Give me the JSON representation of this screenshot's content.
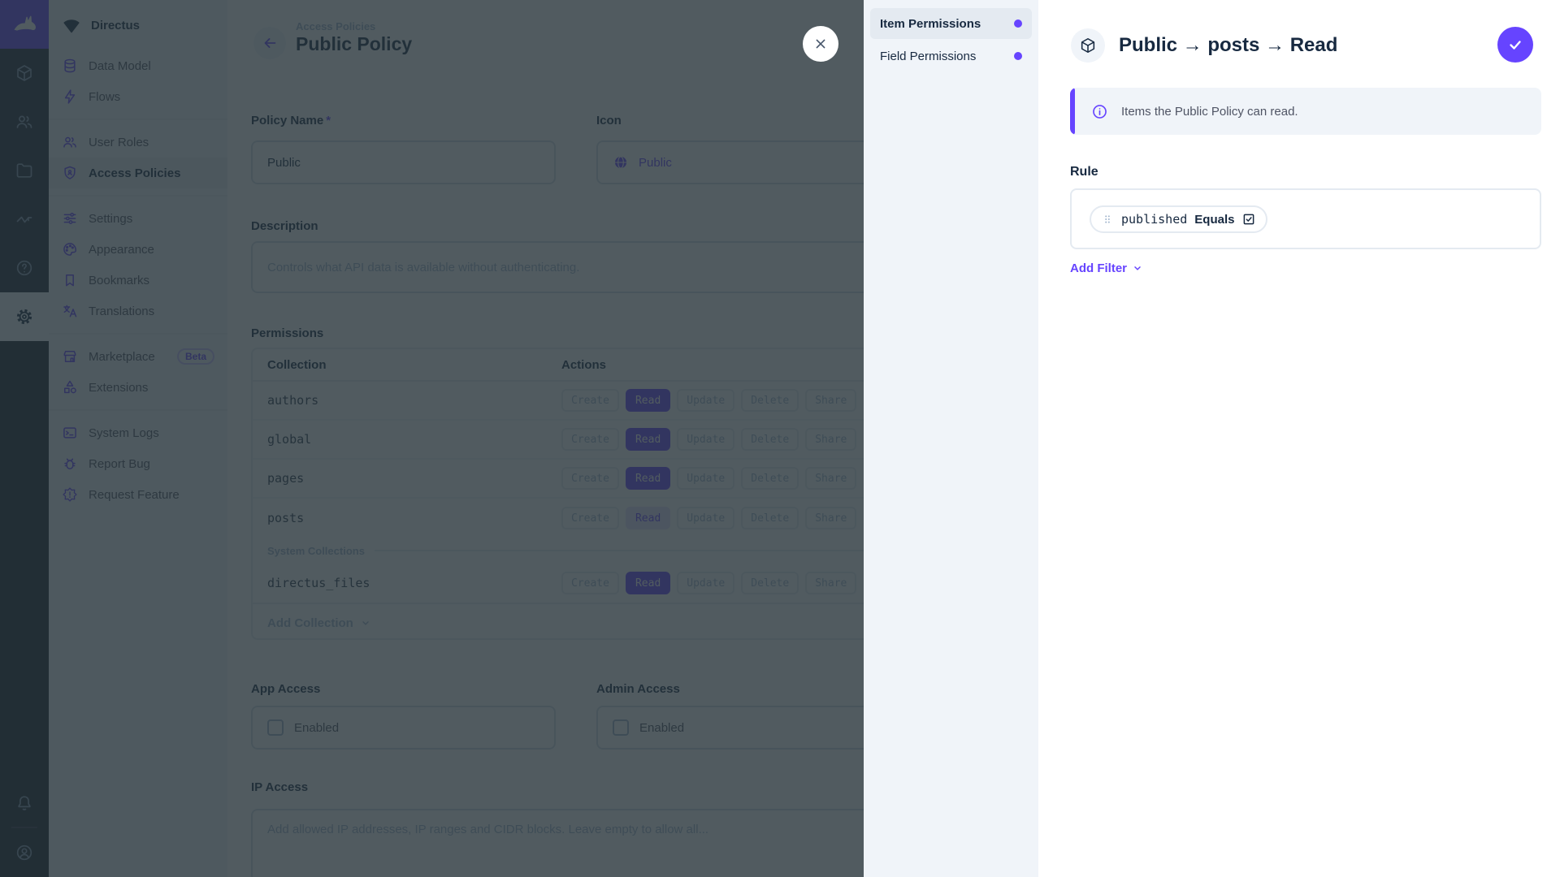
{
  "colors": {
    "accent": "#6644ff",
    "module_bar_bg": "#1d2735",
    "nav_bg": "#f0f4f9",
    "active_bg": "#e4eaf1",
    "text": "#172940",
    "text_subdued": "#a2b5cd",
    "overlay": "rgba(38,50,56,0.8)"
  },
  "nav": {
    "project_name": "Directus",
    "items": [
      {
        "label": "Data Model",
        "icon": "database-icon"
      },
      {
        "label": "Flows",
        "icon": "lightning-icon"
      },
      {
        "label": "User Roles",
        "icon": "user-roles-icon"
      },
      {
        "label": "Access Policies",
        "icon": "shield-person-icon",
        "active": true
      },
      {
        "label": "Settings",
        "icon": "tune-icon"
      },
      {
        "label": "Appearance",
        "icon": "palette-icon"
      },
      {
        "label": "Bookmarks",
        "icon": "bookmark-icon"
      },
      {
        "label": "Translations",
        "icon": "translate-icon"
      },
      {
        "label": "Marketplace",
        "icon": "storefront-icon",
        "badge": "Beta"
      },
      {
        "label": "Extensions",
        "icon": "category-icon"
      },
      {
        "label": "System Logs",
        "icon": "terminal-icon"
      },
      {
        "label": "Report Bug",
        "icon": "bug-icon"
      },
      {
        "label": "Request Feature",
        "icon": "feature-icon"
      }
    ]
  },
  "main": {
    "breadcrumb": "Access Policies",
    "title": "Public Policy",
    "fields": {
      "policy_name": {
        "label": "Policy Name",
        "required_mark": "*",
        "value": "Public"
      },
      "icon": {
        "label": "Icon",
        "value": "Public"
      },
      "description": {
        "label": "Description",
        "value": "Controls what API data is available without authenticating."
      },
      "app_access": {
        "label": "App Access",
        "checkbox_label": "Enabled",
        "checked": false
      },
      "admin_access": {
        "label": "Admin Access",
        "checkbox_label": "Enabled",
        "checked": false
      },
      "ip_access": {
        "label": "IP Access",
        "placeholder": "Add allowed IP addresses, IP ranges and CIDR blocks. Leave empty to allow all..."
      }
    },
    "permissions": {
      "label": "Permissions",
      "columns": {
        "collection": "Collection",
        "actions": "Actions"
      },
      "action_labels": [
        "Create",
        "Read",
        "Update",
        "Delete",
        "Share"
      ],
      "rows": [
        {
          "collection": "authors",
          "read": "full"
        },
        {
          "collection": "global",
          "read": "full"
        },
        {
          "collection": "pages",
          "read": "full"
        },
        {
          "collection": "posts",
          "read": "custom"
        },
        {
          "collection": "directus_files",
          "read": "full",
          "system": true
        }
      ],
      "system_divider": "System Collections",
      "add_collection": "Add Collection"
    }
  },
  "drawer": {
    "tabs": [
      {
        "label": "Item Permissions",
        "active": true
      },
      {
        "label": "Field Permissions"
      }
    ],
    "title": "Public → posts → Read",
    "notice": "Items the Public Policy can read.",
    "rule_label": "Rule",
    "filter": {
      "field": "published",
      "operator": "Equals",
      "checked": true
    },
    "add_filter": "Add Filter"
  }
}
